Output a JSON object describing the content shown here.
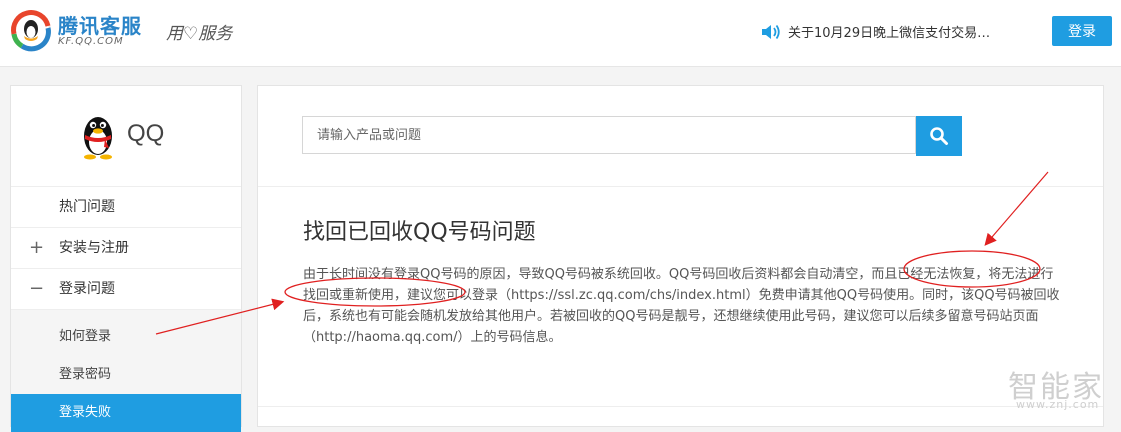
{
  "header": {
    "brand_title": "腾讯客服",
    "brand_subtitle": "KF.QQ.COM",
    "slogan": "用♡服务",
    "notice_text": "关于10月29日晚上微信支付交易…",
    "login_label": "登录",
    "icons": {
      "logo": "tencent-service-logo",
      "notice": "speaker-icon"
    }
  },
  "sidebar": {
    "product_name": "QQ",
    "menu": [
      {
        "label": "热门问题",
        "toggle": ""
      },
      {
        "label": "安装与注册",
        "toggle": "+"
      },
      {
        "label": "登录问题",
        "toggle": "−"
      }
    ],
    "submenu": [
      {
        "label": "如何登录",
        "active": false
      },
      {
        "label": "登录密码",
        "active": false
      },
      {
        "label": "登录失败",
        "active": true
      }
    ]
  },
  "main": {
    "search_placeholder": "请输入产品或问题",
    "article_title": "找回已回收QQ号码问题",
    "article_body": "由于长时间没有登录QQ号码的原因，导致QQ号码被系统回收。QQ号码回收后资料都会自动清空，而且已经无法恢复，将无法进行找回或重新使用，建议您可以登录（https://ssl.zc.qq.com/chs/index.html）免费申请其他QQ号码使用。同时，该QQ号码被回收后，系统也有可能会随机发放给其他用户。若被回收的QQ号码是靓号，还想继续使用此号码，建议您可以后续多留意号码站页面（http://haoma.qq.com/）上的号码信息。"
  },
  "watermark": {
    "main": "智能家",
    "sub": "www.znj.com"
  },
  "colors": {
    "accent": "#1f9de1",
    "annotation": "#e02020",
    "text": "#333333"
  }
}
